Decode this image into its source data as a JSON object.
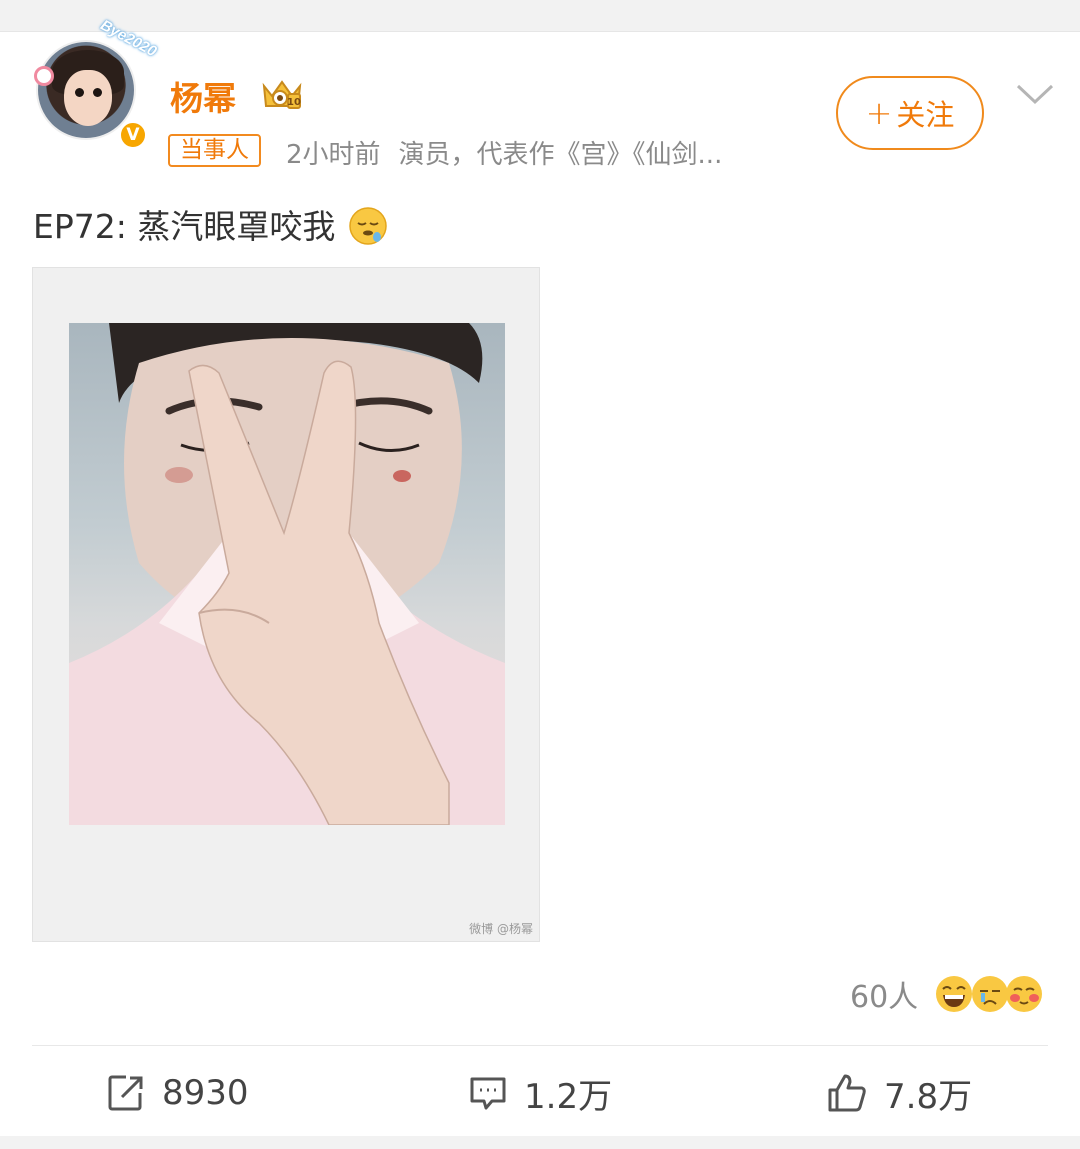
{
  "user": {
    "name": "杨幂",
    "avatar_text": "Bye2020",
    "tag": "当事人",
    "time": "2小时前",
    "description": "演员，代表作《宫》《仙剑...",
    "verified": "V"
  },
  "follow": {
    "label": "关注",
    "plus": "+"
  },
  "post": {
    "text": "EP72: 蒸汽眼罩咬我",
    "image_watermark": "微博 @杨幂"
  },
  "reactions": {
    "count_label": "60人"
  },
  "actions": {
    "repost": "8930",
    "comment": "1.2万",
    "like": "7.8万"
  },
  "colors": {
    "accent": "#f07a0a",
    "muted": "#8a8a8a",
    "background": "#f2f2f2"
  },
  "icons": [
    "vip-crown-icon",
    "chevron-down-icon",
    "repost-icon",
    "comment-icon",
    "like-icon",
    "drool-emoji-icon"
  ]
}
